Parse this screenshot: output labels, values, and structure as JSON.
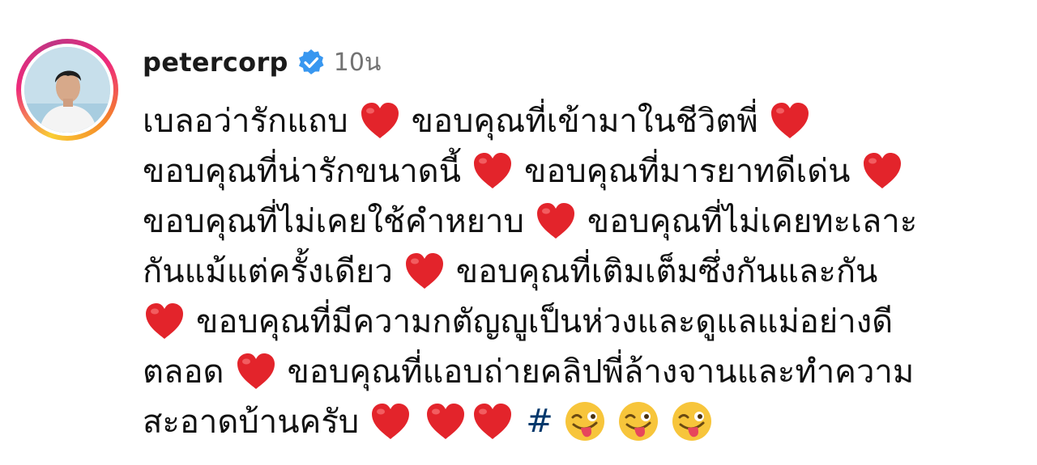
{
  "comment": {
    "username": "petercorp",
    "verified_icon": "verified-badge-icon",
    "timestamp": "10น",
    "lines": [
      "เบลอว่ารักแถบ",
      "ขอบคุณที่เข้ามาในชีวิตพี่",
      "ขอบคุณที่น่ารักขนาดนี้",
      "ขอบคุณที่มารยาทดีเด่น",
      "ขอบคุณที่ไม่เคยใช้คำหยาบ",
      "ขอบคุณที่ไม่เคยทะเลาะ",
      "กันแม้แต่ครั้งเดียว",
      "ขอบคุณที่เติมเต็มซึ่งกันและกัน",
      "ขอบคุณที่มีความกตัญญูเป็นห่วงและดูแลแม่อย่างดี",
      "ตลอด",
      "ขอบคุณที่แอบถ่ายคลิปพี่ล้างจานและทำความ",
      "สะอาดบ้านครับ"
    ],
    "hashtag": "#",
    "emoji": {
      "heart": "red-heart-icon",
      "wink": "winking-face-with-tongue-icon"
    },
    "colors": {
      "heart": "#e3242b",
      "hashtag": "#00376b",
      "verified": "#3897f0",
      "timestamp": "#737373"
    }
  }
}
